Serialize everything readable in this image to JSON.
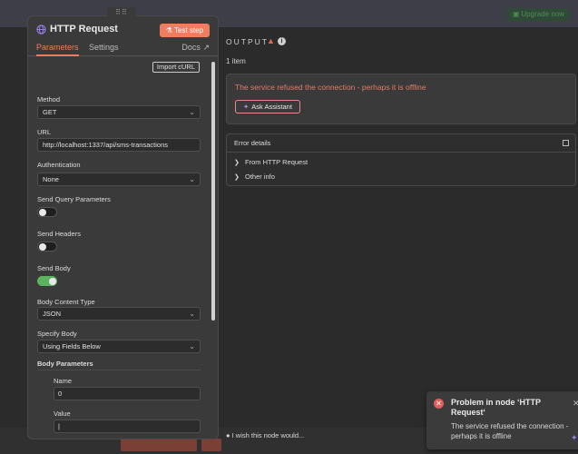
{
  "topbar": {
    "upgrade_label": "Upgrade now",
    "upgrade_icon": "gift-icon"
  },
  "panel": {
    "title": "HTTP Request",
    "test_step": "Test step",
    "tabs": {
      "parameters": "Parameters",
      "settings": "Settings",
      "docs": "Docs"
    },
    "import_curl": "Import cURL",
    "method": {
      "label": "Method",
      "value": "GET"
    },
    "url": {
      "label": "URL",
      "value": "http://localhost:1337/api/sms-transactions"
    },
    "authentication": {
      "label": "Authentication",
      "value": "None"
    },
    "send_query": {
      "label": "Send Query Parameters",
      "enabled": false
    },
    "send_headers": {
      "label": "Send Headers",
      "enabled": false
    },
    "send_body": {
      "label": "Send Body",
      "enabled": true
    },
    "body_content_type": {
      "label": "Body Content Type",
      "value": "JSON"
    },
    "specify_body": {
      "label": "Specify Body",
      "value": "Using Fields Below"
    },
    "body_parameters": {
      "label": "Body Parameters",
      "name_label": "Name",
      "name_value": "0",
      "value_label": "Value",
      "value_value": ""
    }
  },
  "output": {
    "title": "OUTPUT",
    "items": "1 item",
    "error_message": "The service refused the connection - perhaps it is offline",
    "ask_assistant": "Ask Assistant",
    "details_title": "Error details",
    "detail_rows": [
      "From HTTP Request",
      "Other info"
    ]
  },
  "bottom": {
    "wish": "I wish this node would..."
  },
  "toast": {
    "title": "Problem in node ‘HTTP Request‘",
    "body": "The service refused the connection - perhaps it is offline"
  },
  "colors": {
    "accent": "#f07d5e",
    "error": "#e57a68",
    "toggle_on": "#5bb35f"
  }
}
